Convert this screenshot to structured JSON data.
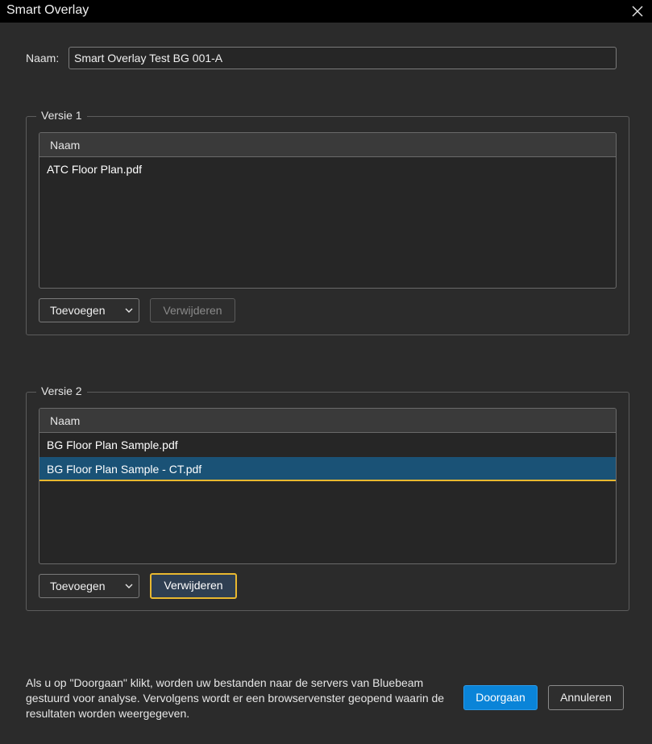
{
  "window": {
    "title": "Smart Overlay",
    "close_icon": "close-icon"
  },
  "name_field": {
    "label": "Naam:",
    "value": "Smart Overlay Test BG 001-A"
  },
  "versie1": {
    "legend": "Versie 1",
    "column_header": "Naam",
    "files": [
      "ATC Floor Plan.pdf"
    ],
    "add_label": "Toevoegen",
    "remove_label": "Verwijderen"
  },
  "versie2": {
    "legend": "Versie 2",
    "column_header": "Naam",
    "files": [
      "BG Floor Plan Sample.pdf",
      "BG Floor Plan Sample - CT.pdf"
    ],
    "selected_index": 1,
    "add_label": "Toevoegen",
    "remove_label": "Verwijderen"
  },
  "footer": {
    "message": "Als u op \"Doorgaan\" klikt, worden uw bestanden naar de servers van Bluebeam gestuurd voor analyse. Vervolgens wordt er een browservenster geopend waarin de resultaten worden weergegeven.",
    "continue_label": "Doorgaan",
    "cancel_label": "Annuleren"
  },
  "colors": {
    "background": "#2b2b2b",
    "titlebar": "#000000",
    "primary_button": "#0a84d8",
    "selection": "#1a5276",
    "focus_outline": "#e8b830"
  }
}
